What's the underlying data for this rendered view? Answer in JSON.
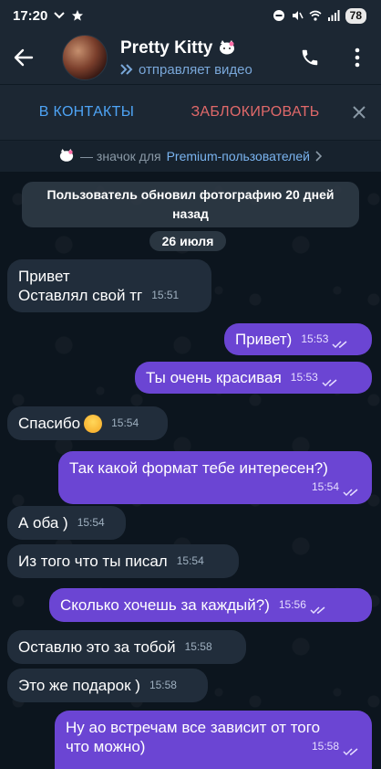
{
  "status_bar": {
    "time": "17:20",
    "battery": "78"
  },
  "header": {
    "title": "Pretty Kitty",
    "subtitle": "отправляет видео"
  },
  "actions": {
    "add_contact": "В КОНТАКТЫ",
    "block": "ЗАБЛОКИРОВАТЬ"
  },
  "premium": {
    "text": "— значок для",
    "link": "Premium-пользователей"
  },
  "chat": {
    "service_message": "Пользователь обновил фотографию 20 дней назад",
    "date": "26 июля",
    "messages": [
      {
        "dir": "in",
        "lines": [
          "Привет",
          "Оставлял свой тг"
        ],
        "time": "15:51"
      },
      {
        "dir": "out",
        "text": "Привет)",
        "time": "15:53",
        "read": true
      },
      {
        "dir": "out",
        "text": "Ты очень красивая",
        "time": "15:53",
        "read": true
      },
      {
        "dir": "in",
        "text": "Спасибо",
        "emoji": "smiling-face",
        "time": "15:54"
      },
      {
        "dir": "out",
        "text": "Так какой формат тебе интересен?)",
        "time": "15:54",
        "read": true
      },
      {
        "dir": "in",
        "text": "А оба )",
        "time": "15:54"
      },
      {
        "dir": "in",
        "text": "Из того что ты писал",
        "time": "15:54"
      },
      {
        "dir": "out",
        "text": "Сколько хочешь за каждый?)",
        "time": "15:56",
        "read": true
      },
      {
        "dir": "in",
        "text": "Оставлю это за тобой",
        "time": "15:58"
      },
      {
        "dir": "in",
        "text": "Это же подарок )",
        "time": "15:58"
      },
      {
        "dir": "out",
        "lines": [
          "Ну ао встречам все зависит от того",
          "что можно)"
        ],
        "time": "15:58",
        "read": true
      }
    ]
  },
  "colors": {
    "header_bg": "#1c2733",
    "chat_bg": "#0c151e",
    "incoming_bubble": "#212d3b",
    "outgoing_bubble": "#6b45d3",
    "link_blue": "#4ea4f6",
    "block_red": "#e1696a"
  }
}
